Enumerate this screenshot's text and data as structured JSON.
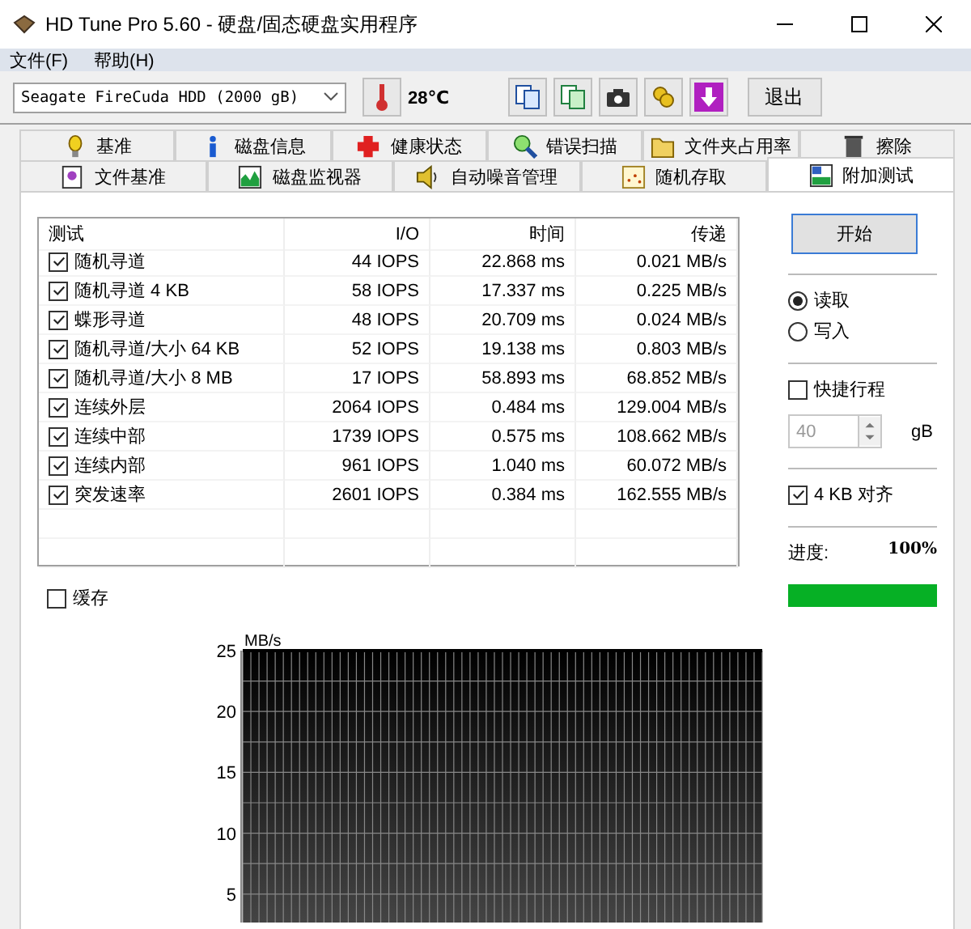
{
  "window": {
    "title": "HD Tune Pro 5.60 - 硬盘/固态硬盘实用程序"
  },
  "menu": [
    "文件(F)",
    "帮助(H)"
  ],
  "toolbar": {
    "drive": "Seagate FireCuda HDD (2000 gB)",
    "temperature": "28℃",
    "exit_button": "退出"
  },
  "tabs_row_1": [
    {
      "label": "基准",
      "selected": false
    },
    {
      "label": "磁盘信息",
      "selected": false
    },
    {
      "label": "健康状态",
      "selected": false
    },
    {
      "label": "错误扫描",
      "selected": false
    },
    {
      "label": "文件夹占用率",
      "selected": false
    },
    {
      "label": "擦除",
      "selected": false
    }
  ],
  "tabs_row_2": [
    {
      "label": "文件基准",
      "selected": false
    },
    {
      "label": "磁盘监视器",
      "selected": false
    },
    {
      "label": "自动噪音管理",
      "selected": false
    },
    {
      "label": "随机存取",
      "selected": false
    },
    {
      "label": "附加测试",
      "selected": true
    }
  ],
  "table": {
    "columns": [
      "测试",
      "I/O",
      "时间",
      "传递"
    ],
    "rows": [
      {
        "name": "随机寻道",
        "checked": true,
        "io": "44 IOPS",
        "time": "22.868 ms",
        "transfer": "0.021 MB/s"
      },
      {
        "name": "随机寻道 4 KB",
        "checked": true,
        "io": "58 IOPS",
        "time": "17.337 ms",
        "transfer": "0.225 MB/s"
      },
      {
        "name": "蝶形寻道",
        "checked": true,
        "io": "48 IOPS",
        "time": "20.709 ms",
        "transfer": "0.024 MB/s"
      },
      {
        "name": "随机寻道/大小 64 KB",
        "checked": true,
        "io": "52 IOPS",
        "time": "19.138 ms",
        "transfer": "0.803 MB/s"
      },
      {
        "name": "随机寻道/大小 8 MB",
        "checked": true,
        "io": "17 IOPS",
        "time": "58.893 ms",
        "transfer": "68.852 MB/s"
      },
      {
        "name": "连续外层",
        "checked": true,
        "io": "2064 IOPS",
        "time": "0.484 ms",
        "transfer": "129.004 MB/s"
      },
      {
        "name": "连续中部",
        "checked": true,
        "io": "1739 IOPS",
        "time": "0.575 ms",
        "transfer": "108.662 MB/s"
      },
      {
        "name": "连续内部",
        "checked": true,
        "io": "961 IOPS",
        "time": "1.040 ms",
        "transfer": "60.072 MB/s"
      },
      {
        "name": "突发速率",
        "checked": true,
        "io": "2601 IOPS",
        "time": "0.384 ms",
        "transfer": "162.555 MB/s"
      }
    ]
  },
  "cache": {
    "label": "缓存",
    "checked": false
  },
  "chart": {
    "axis_title": "MB/s",
    "y_tick_labels": [
      "25",
      "20",
      "15",
      "10",
      "5"
    ]
  },
  "side": {
    "start_button": "开始",
    "modes": [
      {
        "label": "读取",
        "selected": true
      },
      {
        "label": "写入",
        "selected": false
      }
    ],
    "short_stroke": {
      "label": "快捷行程",
      "checked": false
    },
    "stroke_size": {
      "value": "40",
      "disabled": true,
      "unit": "gB"
    },
    "align": {
      "label": "4 KB 对齐",
      "checked": true
    },
    "progress": {
      "label": "进度:",
      "value": "100%",
      "level": 1
    }
  }
}
